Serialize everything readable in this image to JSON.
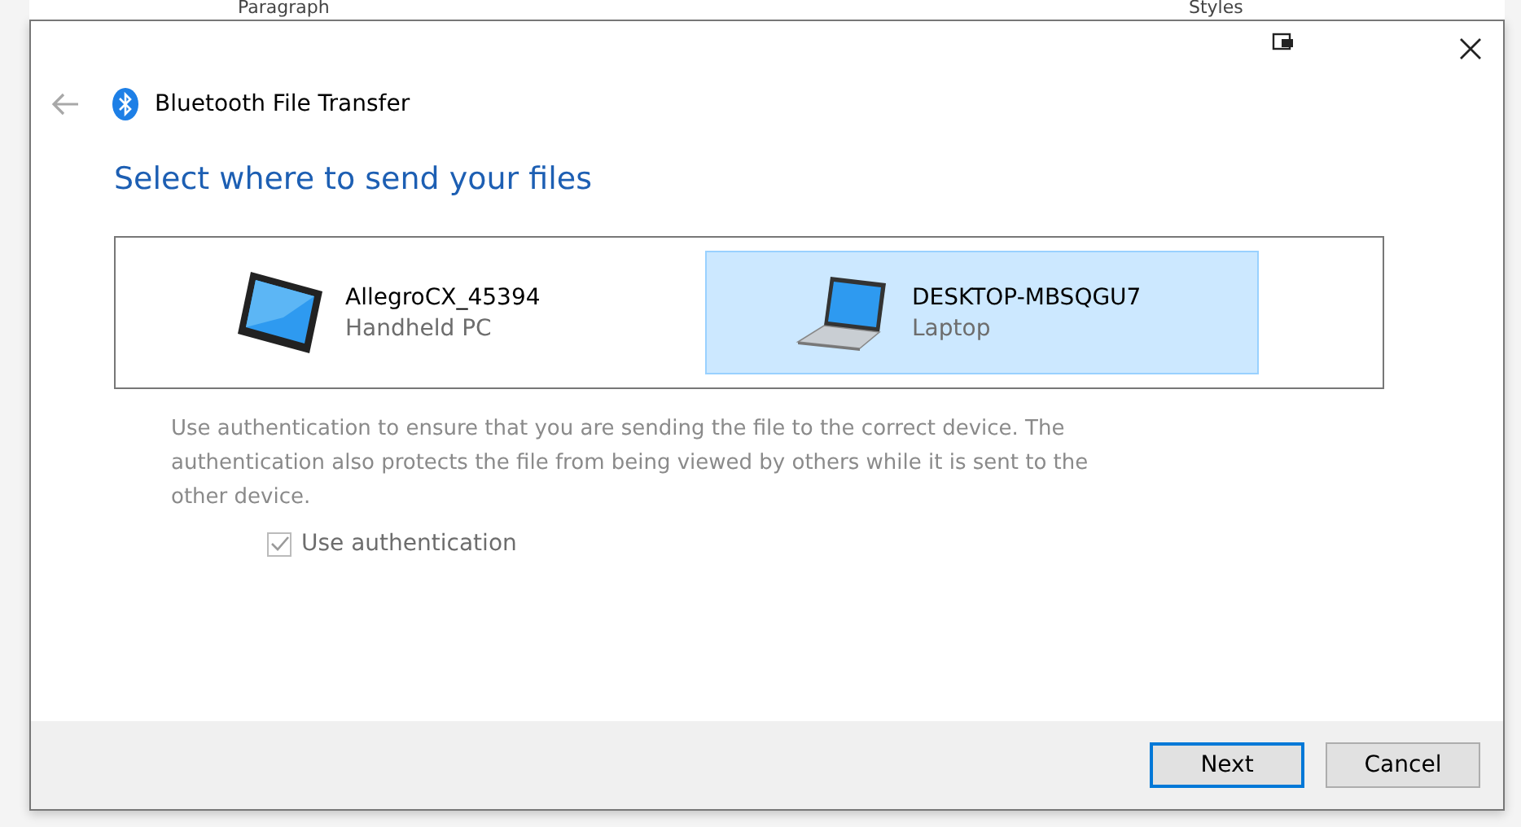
{
  "background_app": {
    "ribbon_groups": [
      "Paragraph",
      "Styles"
    ]
  },
  "window": {
    "title": "Bluetooth File Transfer",
    "back_disabled": true
  },
  "heading": "Select where to send your files",
  "devices": [
    {
      "name": "AllegroCX_45394",
      "type_label": "Handheld PC",
      "kind": "tablet",
      "selected": false
    },
    {
      "name": "DESKTOP-MBSQGU7",
      "type_label": "Laptop",
      "kind": "laptop",
      "selected": true
    }
  ],
  "description": "Use authentication to ensure that you are sending the file to the correct device. The authentication also protects the file from being viewed by others while it is sent to the other device.",
  "auth_checkbox": {
    "label": "Use authentication",
    "checked": true,
    "disabled": true
  },
  "buttons": [
    {
      "label": "Next",
      "default": true
    },
    {
      "label": "Cancel",
      "default": false
    }
  ]
}
